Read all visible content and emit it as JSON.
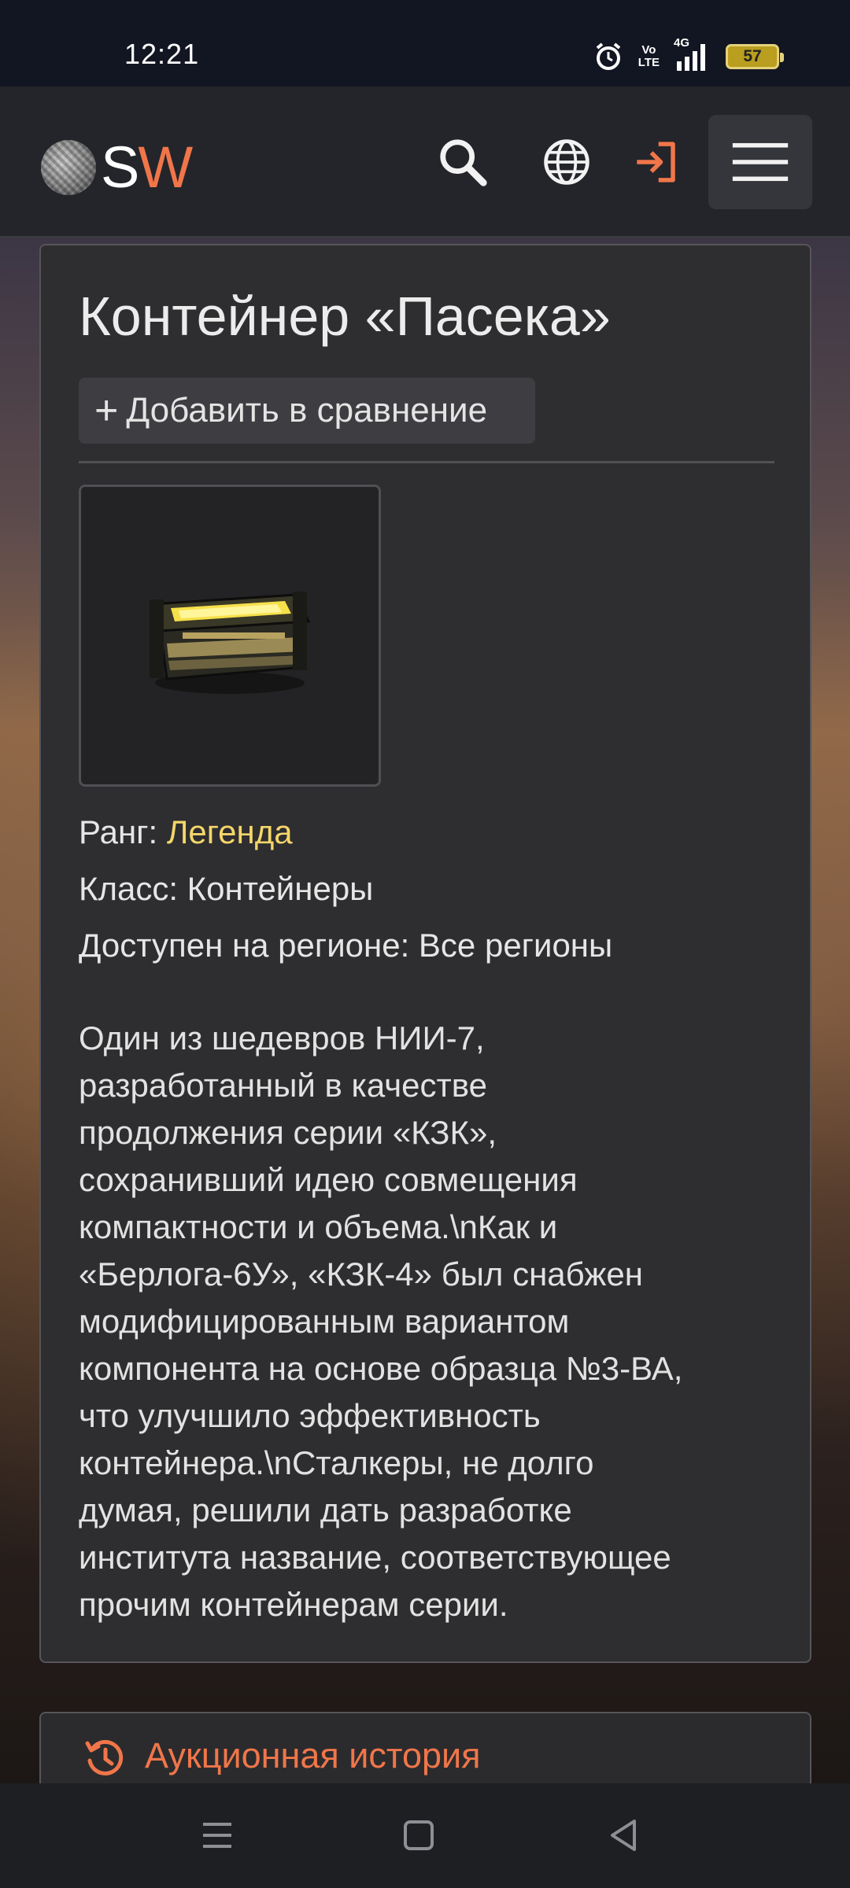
{
  "status_bar": {
    "time": "12:21",
    "network": "4G",
    "volte_line1": "Vo",
    "volte_line2": "LTE",
    "battery": "57"
  },
  "header": {
    "logo_s": "S",
    "logo_w": "W",
    "icons": [
      "search-icon",
      "globe-icon",
      "login-icon",
      "menu-icon"
    ]
  },
  "item": {
    "title": "Контейнер «Пасека»",
    "compare_label": "Добавить в сравнение",
    "rank_label": "Ранг: ",
    "rank_value": "Легенда",
    "rank_color": "#f5d66a",
    "class_text": "Класс: Контейнеры",
    "region_text": "Доступен на регионе: Все регионы",
    "description_lines": [
      "Один из шедевров НИИ-7,",
      "разработанный в качестве",
      "продолжения серии «КЗК»,",
      "сохранивший идею совмещения",
      "компактности и объема.\\nКак и",
      "«Берлога-6У», «КЗК-4» был снабжен",
      "модифицированным вариантом",
      "компонента на основе образца №3-ВА,",
      "что улучшило эффективность",
      "контейнера.\\nСталкеры, не долго",
      "думая, решили дать разработке",
      "института название, соответствующее",
      "прочим контейнерам серии."
    ]
  },
  "auction": {
    "title": "Аукционная история"
  },
  "colors": {
    "accent": "#f0764a",
    "card_bg": "#2e2e30",
    "header_bg": "#24252a"
  }
}
